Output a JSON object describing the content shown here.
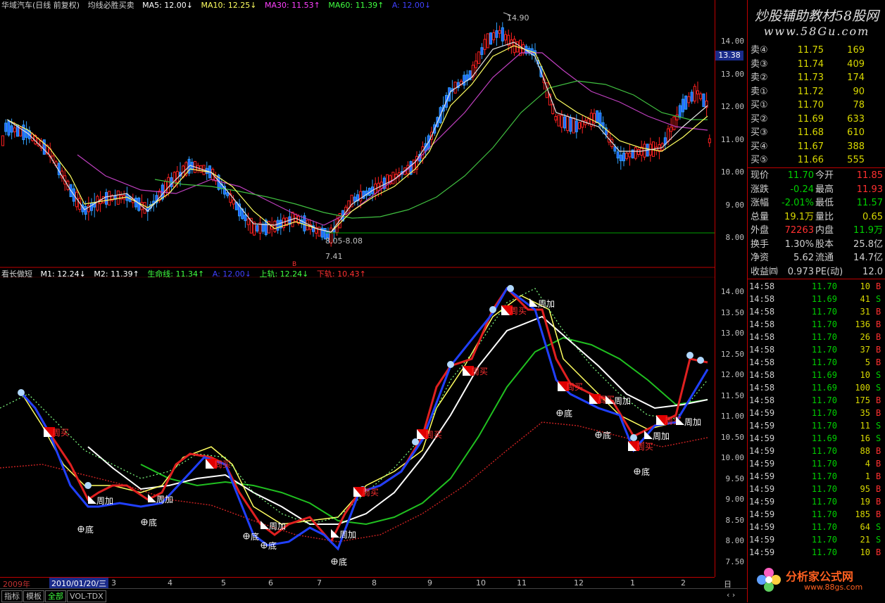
{
  "top_header": {
    "stock": "华域汽车(日线 前复权)",
    "formula": "均线必胜买卖",
    "ma5": "MA5: 12.00↓",
    "ma10": "MA10: 12.25↓",
    "ma30": "MA30: 11.53↑",
    "ma60": "MA60: 11.39↑",
    "extra": "A: 12.00↓"
  },
  "bottom_header": {
    "name": "看长做短",
    "m1": "M1: 12.24↓",
    "m2": "M2: 11.39↑",
    "life": "生命线: 11.34↑",
    "a": "A: 12.00↓",
    "upper": "上轨: 12.24↓",
    "lower": "下轨: 10.43↑"
  },
  "top_axis": [
    "14.00",
    "13.00",
    "12.00",
    "11.00",
    "10.00",
    "9.00",
    "8.00"
  ],
  "bottom_axis": [
    "14.00",
    "13.50",
    "13.00",
    "12.50",
    "12.00",
    "11.50",
    "11.00",
    "10.50",
    "10.00",
    "9.50",
    "9.00",
    "8.50",
    "8.00",
    "7.50"
  ],
  "current_price_tag": "13.38",
  "annotations": {
    "high": "14.90",
    "low": "7.41",
    "range": "8.05-8.08",
    "marker": "B"
  },
  "time_axis": {
    "year": "2009年",
    "cursor_date": "2010/01/20/三",
    "months": [
      "3",
      "4",
      "5",
      "6",
      "7",
      "8",
      "9",
      "10",
      "11",
      "12",
      "1",
      "2"
    ],
    "period": "日线"
  },
  "bottom_tabs": [
    "指标",
    "模板",
    "全部",
    "VOL-TDX"
  ],
  "watermark": {
    "line1": "炒股辅助教材58股网",
    "line2": "www.58Gu.com"
  },
  "order_book": {
    "sell": [
      {
        "label": "卖④",
        "price": "11.75",
        "vol": "169"
      },
      {
        "label": "卖③",
        "price": "11.74",
        "vol": "409"
      },
      {
        "label": "卖②",
        "price": "11.73",
        "vol": "174"
      },
      {
        "label": "卖①",
        "price": "11.72",
        "vol": "90"
      }
    ],
    "buy": [
      {
        "label": "买①",
        "price": "11.70",
        "vol": "78"
      },
      {
        "label": "买②",
        "price": "11.69",
        "vol": "633"
      },
      {
        "label": "买③",
        "price": "11.68",
        "vol": "610"
      },
      {
        "label": "买④",
        "price": "11.67",
        "vol": "388"
      },
      {
        "label": "买⑤",
        "price": "11.66",
        "vol": "555"
      }
    ]
  },
  "quote": [
    {
      "k1": "现价",
      "v1": "11.70",
      "k2": "今开",
      "v2": "11.85",
      "c1": "#00d000",
      "c2": "#ff3030"
    },
    {
      "k1": "涨跌",
      "v1": "-0.24",
      "k2": "最高",
      "v2": "11.93",
      "c1": "#00d000",
      "c2": "#ff3030"
    },
    {
      "k1": "涨幅",
      "v1": "-2.01%",
      "k2": "最低",
      "v2": "11.57",
      "c1": "#00d000",
      "c2": "#00d000"
    },
    {
      "k1": "总量",
      "v1": "19.1万",
      "k2": "量比",
      "v2": "0.65",
      "c1": "#d8d800",
      "c2": "#d8d800"
    },
    {
      "k1": "外盘",
      "v1": "72263",
      "k2": "内盘",
      "v2": "11.9万",
      "c1": "#ff3030",
      "c2": "#00d000"
    },
    {
      "k1": "换手",
      "v1": "1.30%",
      "k2": "股本",
      "v2": "25.8亿",
      "c1": "#d0d0d0",
      "c2": "#d0d0d0"
    },
    {
      "k1": "净资",
      "v1": "5.62",
      "k2": "流通",
      "v2": "14.7亿",
      "c1": "#d0d0d0",
      "c2": "#d0d0d0"
    },
    {
      "k1": "收益㈣",
      "v1": "0.973",
      "k2": "PE(动)",
      "v2": "12.0",
      "c1": "#d0d0d0",
      "c2": "#d0d0d0"
    }
  ],
  "ticks": [
    {
      "t": "14:58",
      "p": "11.70",
      "v": "10",
      "bs": "B"
    },
    {
      "t": "14:58",
      "p": "11.69",
      "v": "41",
      "bs": "S"
    },
    {
      "t": "14:58",
      "p": "11.70",
      "v": "31",
      "bs": "B"
    },
    {
      "t": "14:58",
      "p": "11.70",
      "v": "136",
      "bs": "B"
    },
    {
      "t": "14:58",
      "p": "11.70",
      "v": "26",
      "bs": "B"
    },
    {
      "t": "14:58",
      "p": "11.70",
      "v": "37",
      "bs": "B"
    },
    {
      "t": "14:58",
      "p": "11.70",
      "v": "5",
      "bs": "B"
    },
    {
      "t": "14:58",
      "p": "11.69",
      "v": "10",
      "bs": "S"
    },
    {
      "t": "14:58",
      "p": "11.69",
      "v": "100",
      "bs": "S"
    },
    {
      "t": "14:58",
      "p": "11.70",
      "v": "175",
      "bs": "B"
    },
    {
      "t": "14:59",
      "p": "11.70",
      "v": "35",
      "bs": "B"
    },
    {
      "t": "14:59",
      "p": "11.70",
      "v": "11",
      "bs": "S"
    },
    {
      "t": "14:59",
      "p": "11.69",
      "v": "16",
      "bs": "S"
    },
    {
      "t": "14:59",
      "p": "11.70",
      "v": "88",
      "bs": "B"
    },
    {
      "t": "14:59",
      "p": "11.70",
      "v": "4",
      "bs": "B"
    },
    {
      "t": "14:59",
      "p": "11.70",
      "v": "1",
      "bs": "B"
    },
    {
      "t": "14:59",
      "p": "11.70",
      "v": "95",
      "bs": "B"
    },
    {
      "t": "14:59",
      "p": "11.70",
      "v": "19",
      "bs": "B"
    },
    {
      "t": "14:59",
      "p": "11.70",
      "v": "185",
      "bs": "B"
    },
    {
      "t": "14:59",
      "p": "11.70",
      "v": "64",
      "bs": "S"
    },
    {
      "t": "14:59",
      "p": "11.70",
      "v": "21",
      "bs": "S"
    },
    {
      "t": "14:59",
      "p": "11.70",
      "v": "10",
      "bs": "B"
    }
  ],
  "signal_labels": {
    "buy": "周买",
    "add": "周加",
    "bottom": "底"
  },
  "bottom_logo": "分析家公式网",
  "bottom_logo_url": "www.88gs.com",
  "colors": {
    "up": "#ff3030",
    "down": "#00d000",
    "axis": "#c00000",
    "yellow": "#d8d800"
  }
}
